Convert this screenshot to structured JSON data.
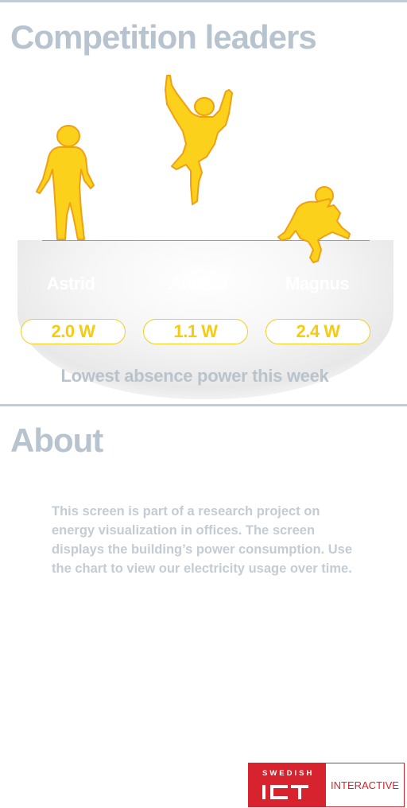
{
  "leaders": {
    "title": "Competition leaders",
    "subtitle": "Lowest absence power this week",
    "accent_color": "#f5cc12",
    "people": [
      {
        "name": "Astrid",
        "power": "2.0 W",
        "pose": "standing-figure"
      },
      {
        "name": "Anders",
        "power": "1.1 W",
        "pose": "jumping-figure"
      },
      {
        "name": "Magnus",
        "power": "2.4 W",
        "pose": "crouching-figure"
      }
    ]
  },
  "about": {
    "title": "About",
    "body": "This screen is part of a research project on energy visualization in offices. The screen displays the building’s power consumption. Use the chart to view our electricity usage over time."
  },
  "logo": {
    "top": "SWEDISH",
    "mark": "ICT",
    "right": "INTERACTIVE",
    "color": "#d6232d"
  }
}
